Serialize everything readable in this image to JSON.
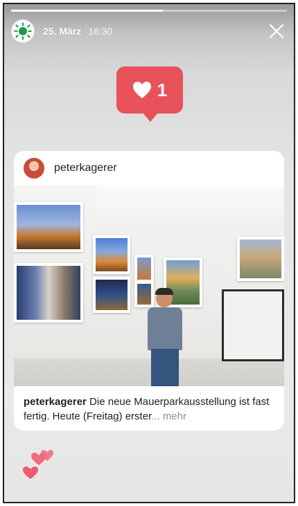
{
  "story": {
    "progress": 0.55,
    "date": "25. März",
    "time": "16:30",
    "likes": "1"
  },
  "post": {
    "username": "peterkagerer",
    "caption_user": "peterkagerer",
    "caption_text": " Die neue Mauerparkausstellung ist fast fertig. Heute (Freitag) erster",
    "ellipsis": "...",
    "more_label": " mehr"
  },
  "colors": {
    "like": "#e8525a",
    "avatar_sun": "#1f9a4a"
  }
}
